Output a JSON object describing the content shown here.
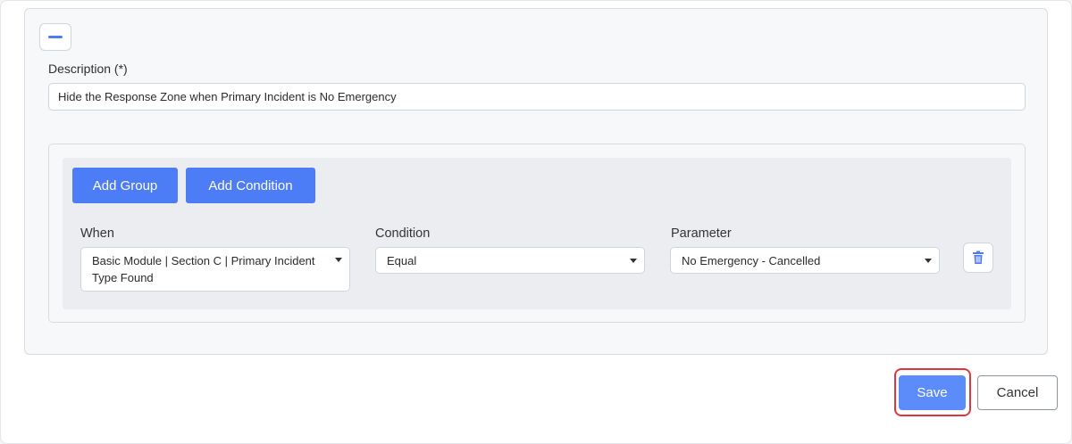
{
  "rule": {
    "description_label": "Description (*)",
    "description_value": "Hide the Response Zone when Primary Incident is No Emergency"
  },
  "builder": {
    "add_group_label": "Add Group",
    "add_condition_label": "Add Condition",
    "when": {
      "label": "When",
      "value_line1": "Basic Module | Section C | Primary Incident",
      "value_line2": "Type Found"
    },
    "condition": {
      "label": "Condition",
      "value": "Equal"
    },
    "parameter": {
      "label": "Parameter",
      "value": "No Emergency - Cancelled"
    }
  },
  "footer": {
    "save_label": "Save",
    "cancel_label": "Cancel"
  },
  "colors": {
    "accent": "#4d7cf7",
    "save_highlight": "#e0353f"
  },
  "icons": {
    "collapse": "minus-icon",
    "delete": "trash-icon",
    "dropdown": "caret-down-icon"
  }
}
